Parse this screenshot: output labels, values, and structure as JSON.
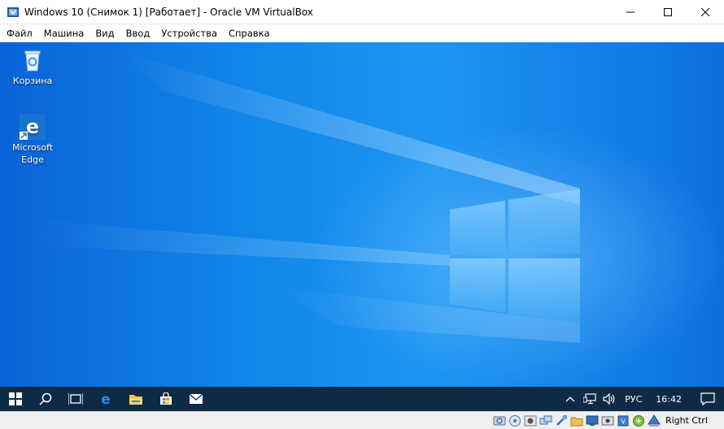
{
  "window": {
    "title": "Windows 10 (Снимок 1) [Работает] - Oracle VM VirtualBox",
    "app_icon": "virtualbox-icon",
    "controls": [
      "minimize-icon",
      "maximize-icon",
      "close-icon"
    ]
  },
  "menubar": {
    "items": [
      "Файл",
      "Машина",
      "Вид",
      "Ввод",
      "Устройства",
      "Справка"
    ]
  },
  "desktop": {
    "background_colors": [
      "#0a63d8",
      "#1e95f2"
    ],
    "icons": [
      {
        "label": "Корзина",
        "icon": "recycle-bin-icon"
      },
      {
        "label": "Microsoft Edge",
        "icon": "edge-icon"
      }
    ],
    "logo": "windows-logo"
  },
  "taskbar": {
    "background": "#0e2a45",
    "pinned": [
      "start-icon",
      "search-icon",
      "task-view-icon",
      "edge-icon",
      "file-explorer-icon",
      "store-icon",
      "mail-icon"
    ],
    "tray": {
      "icons": [
        "chevron-up-icon",
        "network-icon",
        "volume-icon"
      ],
      "language": "РУС",
      "time": "16:42",
      "notification_icon": "action-center-icon"
    }
  },
  "statusbar": {
    "icons": [
      "hdd-icon",
      "optical-drive-icon",
      "audio-icon",
      "network-adapter-icon",
      "usb-icon",
      "shared-folder-icon",
      "display-icon",
      "video-capture-icon",
      "cpu-icon",
      "mouse-integration-icon",
      "keyboard-icon"
    ],
    "host_key": "Right Ctrl"
  }
}
